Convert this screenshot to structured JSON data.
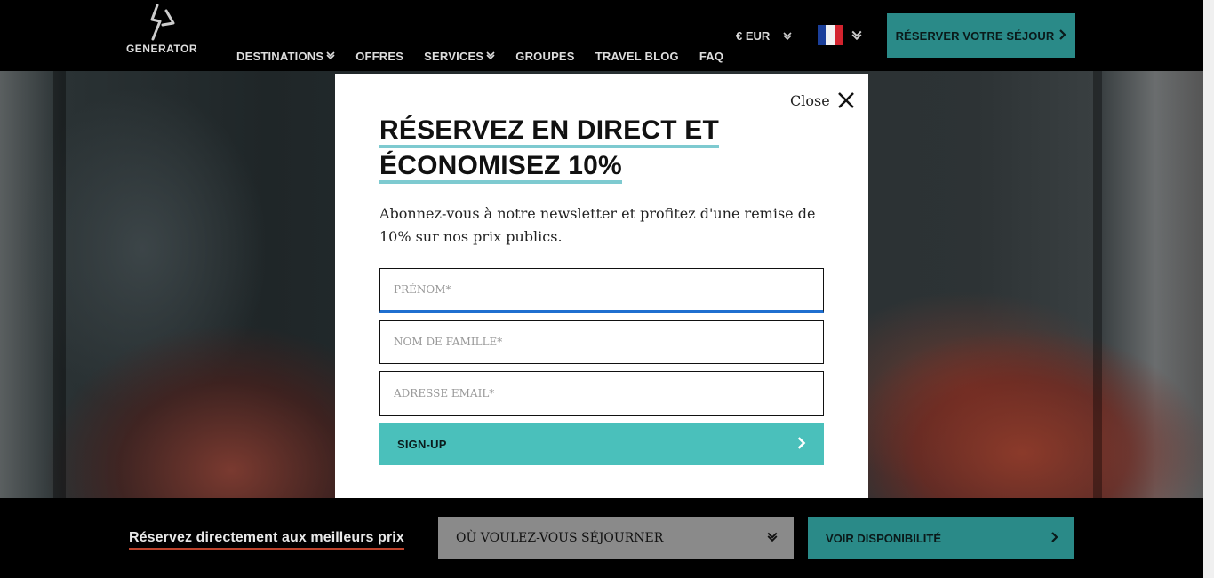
{
  "header": {
    "logo_text": "GENERATOR",
    "nav": [
      {
        "label": "DESTINATIONS",
        "has_dropdown": true
      },
      {
        "label": "OFFRES",
        "has_dropdown": false
      },
      {
        "label": "SERVICES",
        "has_dropdown": true
      },
      {
        "label": "GROUPES",
        "has_dropdown": false
      },
      {
        "label": "TRAVEL BLOG",
        "has_dropdown": false
      },
      {
        "label": "FAQ",
        "has_dropdown": false
      }
    ],
    "currency": "€ EUR",
    "language_flag": "fr",
    "reserve_label": "RÉSERVER VOTRE SÉJOUR"
  },
  "modal": {
    "close_label": "Close",
    "title_line1": "RÉSERVEZ EN DIRECT ET",
    "title_line2": "ÉCONOMISEZ 10%",
    "description": "Abonnez-vous à notre newsletter et profitez d'une remise de 10% sur nos prix publics.",
    "fields": {
      "first_name": {
        "placeholder": "PRÉNOM*",
        "value": ""
      },
      "last_name": {
        "placeholder": "NOM DE FAMILLE*",
        "value": ""
      },
      "email": {
        "placeholder": "ADRESSE EMAIL*",
        "value": ""
      }
    },
    "submit_label": "SIGN-UP"
  },
  "booking_bar": {
    "tagline": "Réservez directement aux meilleurs prix",
    "destination_placeholder": "OÙ VOULEZ-VOUS SÉJOURNER",
    "availability_label": "VOIR DISPONIBILITÉ"
  },
  "colors": {
    "teal_button": "#2a8a88",
    "signup_button": "#4ac0bb",
    "title_underline": "#7ecad0",
    "focus_blue": "#1f6fd0",
    "tagline_underline": "#c0452e"
  }
}
